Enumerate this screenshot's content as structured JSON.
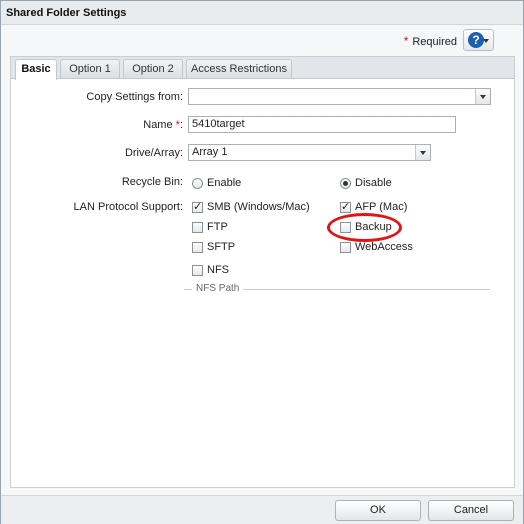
{
  "dialog": {
    "title": "Shared Folder Settings",
    "required_label": "Required",
    "help_icon": "question-icon"
  },
  "tabs": [
    {
      "label": "Basic",
      "active": true
    },
    {
      "label": "Option 1",
      "active": false
    },
    {
      "label": "Option 2",
      "active": false
    },
    {
      "label": "Access Restrictions",
      "active": false
    }
  ],
  "form": {
    "copy_settings": {
      "label": "Copy Settings from:",
      "value": ""
    },
    "name": {
      "label": "Name",
      "required_mark": "*",
      "colon": ":",
      "value": "5410target"
    },
    "drive_array": {
      "label": "Drive/Array:",
      "value": "Array 1"
    },
    "recycle_bin": {
      "label": "Recycle Bin:",
      "options": [
        {
          "label": "Enable",
          "checked": false
        },
        {
          "label": "Disable",
          "checked": true
        }
      ]
    },
    "lan_protocol": {
      "label": "LAN Protocol Support:",
      "options": [
        {
          "label": "SMB (Windows/Mac)",
          "checked": true
        },
        {
          "label": "AFP (Mac)",
          "checked": true
        },
        {
          "label": "FTP",
          "checked": false
        },
        {
          "label": "Backup",
          "checked": false
        },
        {
          "label": "SFTP",
          "checked": false
        },
        {
          "label": "WebAccess",
          "checked": false
        },
        {
          "label": "NFS",
          "checked": false
        }
      ]
    },
    "nfs_path_legend": "NFS Path"
  },
  "footer": {
    "ok_label": "OK",
    "cancel_label": "Cancel"
  },
  "colors": {
    "required_star": "#dd1111",
    "highlight": "#e01515",
    "help_blue": "#1d5fb5"
  }
}
